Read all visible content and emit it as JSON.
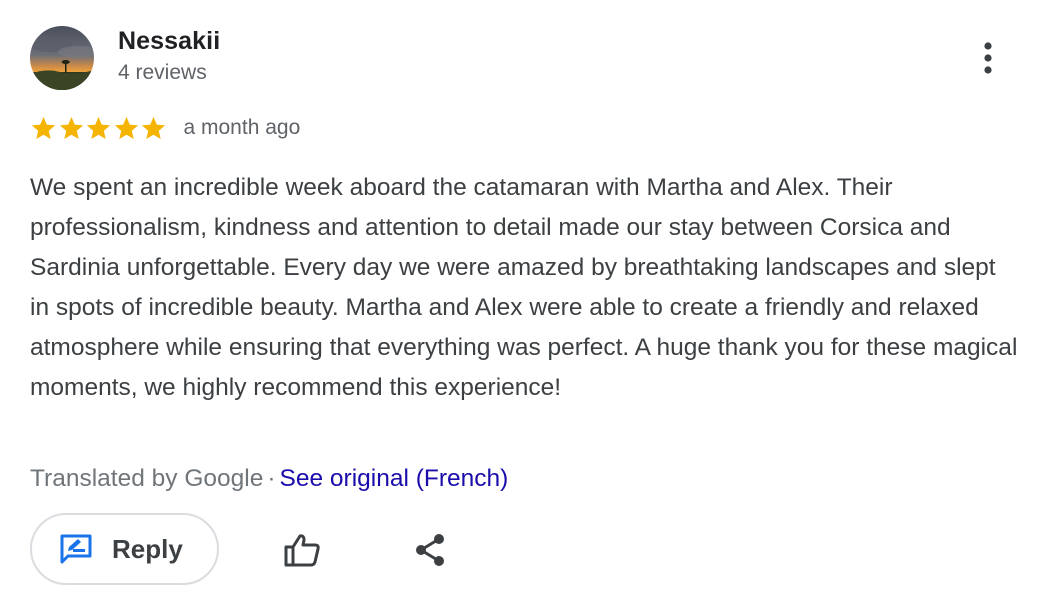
{
  "review": {
    "reviewer_name": "Nessakii",
    "review_count": "4 reviews",
    "rating": 5,
    "rating_max": 5,
    "date": "a month ago",
    "text": "We spent an incredible week aboard the catamaran with Martha and Alex. Their professionalism, kindness and attention to detail made our stay between Corsica and Sardinia unforgettable. Every day we were amazed by breathtaking landscapes and slept in spots of incredible beauty. Martha and Alex were able to create a friendly and relaxed atmosphere while ensuring that everything was perfect. A huge thank you for these magical moments, we highly recommend this experience!",
    "translated_label": "Translated by Google",
    "separator": "·",
    "see_original_label": "See original (French)"
  },
  "actions": {
    "reply_label": "Reply",
    "reply_icon": "reply-edit-icon",
    "like_icon": "thumb-up-icon",
    "share_icon": "share-icon",
    "more_icon": "more-vert-icon"
  },
  "colors": {
    "star": "#f4b400",
    "link": "#1a0dab",
    "reply_icon": "#1a73e8"
  }
}
